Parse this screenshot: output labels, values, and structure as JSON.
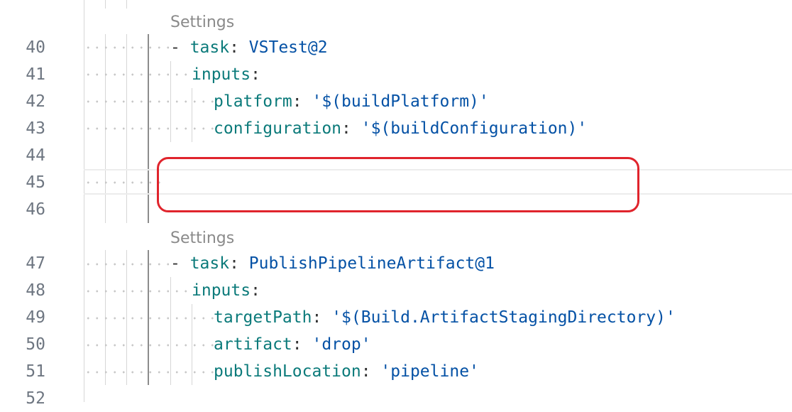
{
  "settings_label": "Settings",
  "lines": [
    {
      "num": "40"
    },
    {
      "num": "41"
    },
    {
      "num": "42"
    },
    {
      "num": "43"
    },
    {
      "num": "44"
    },
    {
      "num": "45"
    },
    {
      "num": "46"
    },
    {
      "num": "47"
    },
    {
      "num": "48"
    },
    {
      "num": "49"
    },
    {
      "num": "50"
    },
    {
      "num": "51"
    },
    {
      "num": "52"
    }
  ],
  "block1": {
    "dash": "- ",
    "task_key": "task",
    "task_value": "VSTest@2",
    "inputs_key": "inputs",
    "platform_key": "platform",
    "platform_value": "'$(buildPlatform)'",
    "configuration_key": "configuration",
    "configuration_value": "'$(buildConfiguration)'"
  },
  "block2": {
    "dash": "- ",
    "task_key": "task",
    "task_value": "PublishPipelineArtifact@1",
    "inputs_key": "inputs",
    "targetPath_key": "targetPath",
    "targetPath_value": "'$(Build.ArtifactStagingDirectory)'",
    "artifact_key": "artifact",
    "artifact_value": "'drop'",
    "publishLocation_key": "publishLocation",
    "publishLocation_value": "'pipeline'"
  },
  "colon": ": ",
  "colors": {
    "key": "#0b7a7a",
    "string": "#0451a5",
    "line_number": "#6e7681",
    "codelens": "#8a8a8a",
    "highlight": "#e0242c"
  }
}
